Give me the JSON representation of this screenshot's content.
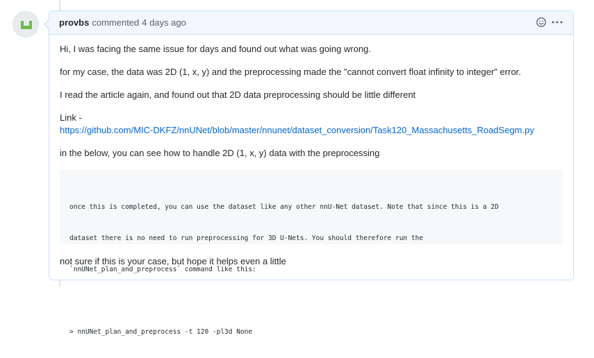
{
  "comment": {
    "author": "provbs",
    "action": "commented",
    "timestamp": "4 days ago",
    "paragraphs": [
      "Hi, I was facing the same issue for days and found out what was going wrong.",
      "for my case, the data was 2D (1, x, y) and the preprocessing made the \"cannot convert float infinity to integer\" error.",
      "I read the article again, and found out that 2D data preprocessing should be little different"
    ],
    "link_label": "Link -",
    "link_url": "https://github.com/MIC-DKFZ/nnUNet/blob/master/nnunet/dataset_conversion/Task120_Massachusetts_RoadSegm.py",
    "para_after_link": "in the below, you can see how to handle 2D (1, x, y) data with the preprocessing",
    "code_lines": [
      "once this is completed, you can use the dataset like any other nnU-Net dataset. Note that since this is a 2D",
      "dataset there is no need to run preprocessing for 3D U-Nets. You should therefore run the",
      "`nnUNet_plan_and_preprocess` command like this:",
      "",
      "> nnUNet_plan_and_preprocess -t 120 -pl3d None"
    ],
    "closing": "not sure if this is your case, but hope it helps even a little"
  },
  "header_icons": [
    "smiley-icon",
    "kebab-menu-icon"
  ],
  "colors": {
    "header_bg": "#f1f8ff",
    "border": "#c8e1ff",
    "link": "#0366d6",
    "code_bg": "#f6f8fa",
    "avatar_green": "#6bbf47"
  }
}
